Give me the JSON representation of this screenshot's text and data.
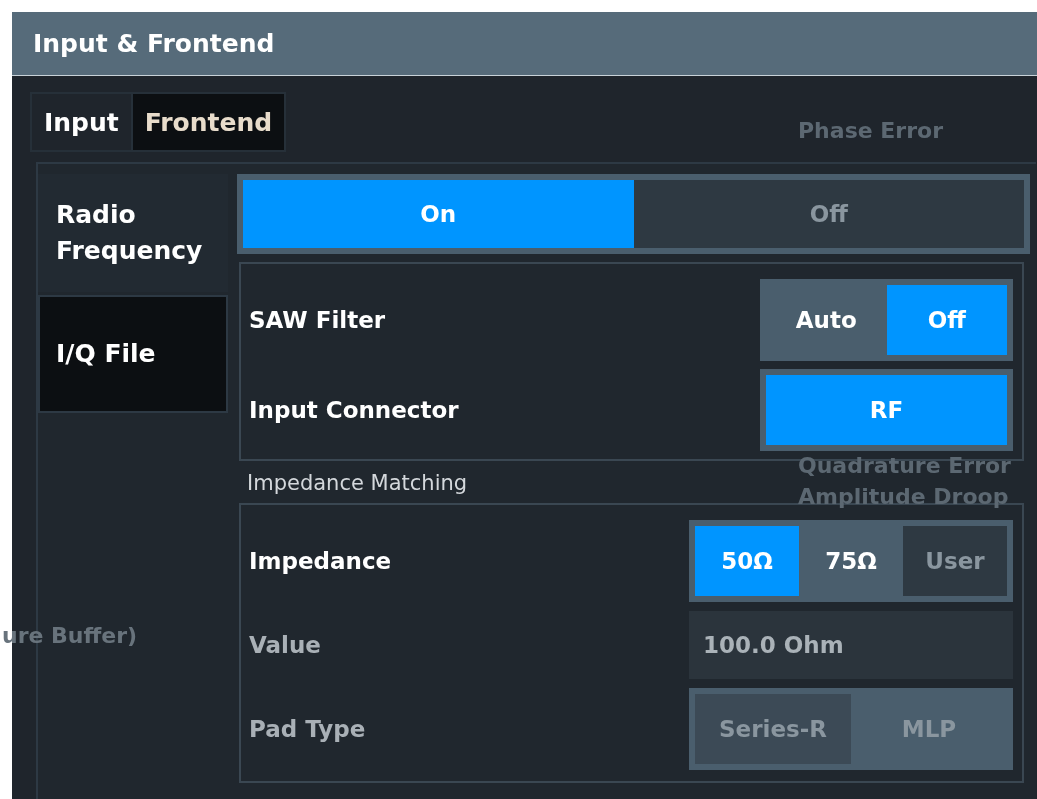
{
  "background": [
    {
      "text": "Phase Error"
    },
    {
      "text": "Quadrature Error"
    },
    {
      "text": "Amplitude Droop"
    },
    {
      "text": "ure Buffer)"
    }
  ],
  "dialog": {
    "title": "Input & Frontend"
  },
  "tabs": [
    {
      "label": "Input",
      "selected": true
    },
    {
      "label": "Frontend",
      "selected": false
    }
  ],
  "nav": [
    {
      "label": "Radio Frequency",
      "selected": true
    },
    {
      "label": "I/Q File",
      "selected": false
    }
  ],
  "rf_switch": [
    {
      "label": "On",
      "selected": true
    },
    {
      "label": "Off",
      "selected": false
    }
  ],
  "groups": [
    {
      "rows": [
        {
          "label": "SAW Filter",
          "kind": "toggle",
          "disabled": false,
          "options": [
            {
              "label": "Auto",
              "selected": false,
              "disabled": false
            },
            {
              "label": "Off",
              "selected": true,
              "disabled": false
            }
          ]
        },
        {
          "label": "Input Connector",
          "kind": "toggle",
          "disabled": false,
          "options": [
            {
              "label": "RF",
              "selected": true,
              "disabled": false
            }
          ]
        }
      ]
    },
    {
      "title": "Impedance Matching",
      "rows": [
        {
          "label": "Impedance",
          "kind": "toggle",
          "disabled": false,
          "options": [
            {
              "label": "50Ω",
              "selected": true,
              "disabled": false
            },
            {
              "label": "75Ω",
              "selected": false,
              "disabled": false
            },
            {
              "label": "User",
              "selected": false,
              "disabled": true
            }
          ]
        },
        {
          "label": "Value",
          "kind": "field",
          "disabled": true,
          "value": "100.0 Ohm"
        },
        {
          "label": "Pad Type",
          "kind": "toggle",
          "disabled": true,
          "options": [
            {
              "label": "Series-R",
              "selected": true
            },
            {
              "label": "MLP",
              "selected": false
            }
          ]
        }
      ]
    }
  ]
}
